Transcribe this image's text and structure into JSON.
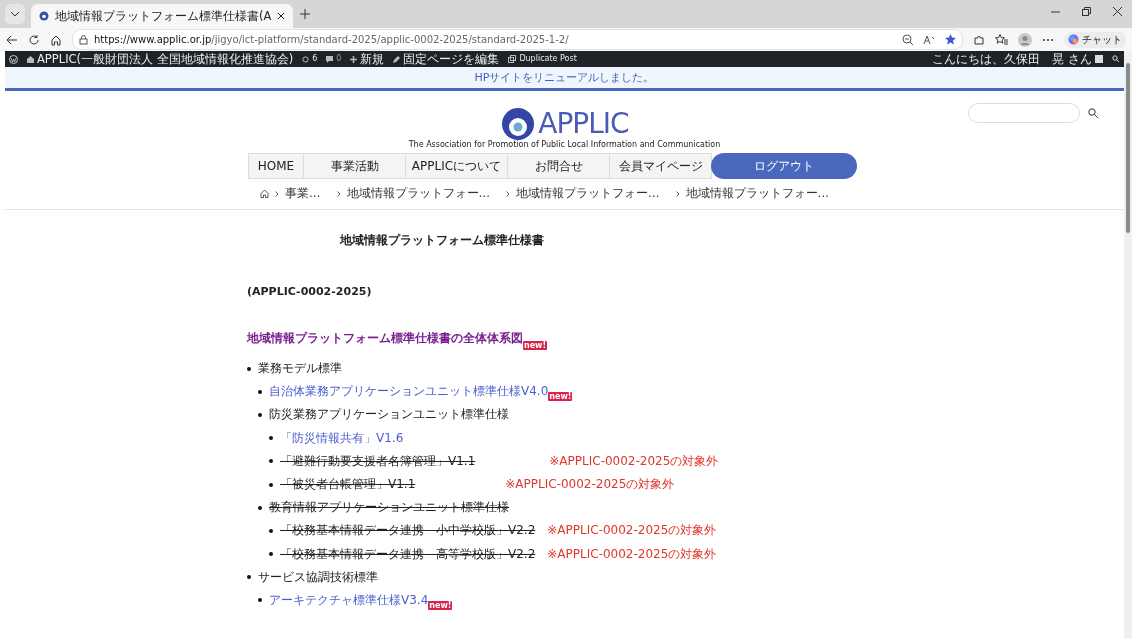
{
  "browser": {
    "tab_title": "地域情報プラットフォーム標準仕様書(A",
    "url_host": "https://www.applic.or.jp",
    "url_path": "/jigyo/ict-platform/standard-2025/applic-0002-2025/standard-2025-1-2/",
    "copilot_label": "チャット"
  },
  "admin_bar": {
    "site": "APPLIC(一般財団法人 全国地域情報化推進協会)",
    "updates": "6",
    "comments": "0",
    "new": "新規",
    "edit": "固定ページを編集",
    "duplicate": "Duplicate Post",
    "greeting": "こんにちは、久保田　晃 さん"
  },
  "notice": "HPサイトをリニューアルしました。",
  "header": {
    "logo": "APPLIC",
    "tagline": "The Association for Promotion of Public Local Information and Communication"
  },
  "nav": [
    {
      "label": "HOME",
      "kind": "tab"
    },
    {
      "label": "事業活動",
      "kind": "tab"
    },
    {
      "label": "APPLICについて",
      "kind": "tab"
    },
    {
      "label": "お問合せ",
      "kind": "tab"
    },
    {
      "label": "会員マイページ",
      "kind": "tab"
    },
    {
      "label": "ログアウト",
      "kind": "pill"
    }
  ],
  "breadcrumb": [
    "事業…",
    "地域情報プラットフォー…",
    "地域情報プラットフォー…",
    "地域情報プラットフォー…"
  ],
  "content": {
    "title": "地域情報プラットフォーム標準仕様書",
    "code": "(APPLIC-0002-2025)",
    "overview_link": "地域情報プラットフォーム標準仕様書の全体体系図",
    "overview_badge": "new!",
    "items": [
      {
        "text": "業務モデル標準",
        "link": false,
        "struck": false,
        "children": [
          {
            "text": "自治体業務アプリケーションユニット標準仕様V4.0",
            "link": true,
            "struck": false,
            "badge": "new!"
          },
          {
            "text": "防災業務アプリケーションユニット標準仕様",
            "link": false,
            "struck": false,
            "children": [
              {
                "text": "「防災情報共有」V1.6",
                "link": true,
                "struck": false
              },
              {
                "text": "「避難行動要支援者名簿管理」V1.1",
                "link": false,
                "struck": true,
                "note": "※APPLIC-0002-2025の対象外"
              },
              {
                "text": "「被災者台帳管理」V1.1",
                "link": false,
                "struck": true,
                "note": "※APPLIC-0002-2025の対象外"
              }
            ]
          },
          {
            "text": "教育情報アプリケーションユニット標準仕様",
            "link": false,
            "struck": true,
            "children": [
              {
                "text": "「校務基本情報データ連携　小中学校版」V2.2",
                "link": false,
                "struck": true,
                "note": "※APPLIC-0002-2025の対象外"
              },
              {
                "text": "「校務基本情報データ連携　高等学校版」V2.2",
                "link": false,
                "struck": true,
                "note": "※APPLIC-0002-2025の対象外"
              }
            ]
          }
        ]
      },
      {
        "text": "サービス協調技術標準",
        "link": false,
        "struck": false,
        "children": [
          {
            "text": "アーキテクチャ標準仕様V3.4",
            "link": true,
            "struck": false,
            "badge": "new!"
          }
        ]
      }
    ]
  }
}
